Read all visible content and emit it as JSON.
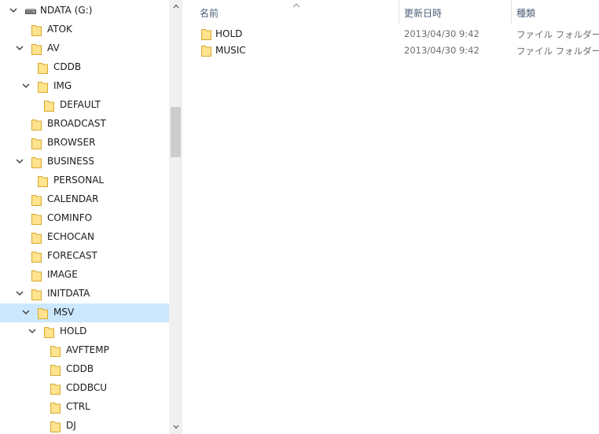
{
  "tree": {
    "drive": {
      "label": "NDATA (G:)",
      "expanded": true
    },
    "items": [
      {
        "label": "ATOK",
        "depth": 1,
        "expander": "none"
      },
      {
        "label": "AV",
        "depth": 1,
        "expander": "expanded"
      },
      {
        "label": "CDDB",
        "depth": 2,
        "expander": "none"
      },
      {
        "label": "IMG",
        "depth": 2,
        "expander": "expanded"
      },
      {
        "label": "DEFAULT",
        "depth": 3,
        "expander": "none"
      },
      {
        "label": "BROADCAST",
        "depth": 1,
        "expander": "none"
      },
      {
        "label": "BROWSER",
        "depth": 1,
        "expander": "none"
      },
      {
        "label": "BUSINESS",
        "depth": 1,
        "expander": "expanded"
      },
      {
        "label": "PERSONAL",
        "depth": 2,
        "expander": "none"
      },
      {
        "label": "CALENDAR",
        "depth": 1,
        "expander": "none"
      },
      {
        "label": "COMINFO",
        "depth": 1,
        "expander": "none"
      },
      {
        "label": "ECHOCAN",
        "depth": 1,
        "expander": "none"
      },
      {
        "label": "FORECAST",
        "depth": 1,
        "expander": "none"
      },
      {
        "label": "IMAGE",
        "depth": 1,
        "expander": "none"
      },
      {
        "label": "INITDATA",
        "depth": 1,
        "expander": "expanded"
      },
      {
        "label": "MSV",
        "depth": 2,
        "expander": "expanded",
        "selected": true
      },
      {
        "label": "HOLD",
        "depth": 3,
        "expander": "expanded"
      },
      {
        "label": "AVFTEMP",
        "depth": 4,
        "expander": "none"
      },
      {
        "label": "CDDB",
        "depth": 4,
        "expander": "none"
      },
      {
        "label": "CDDBCU",
        "depth": 4,
        "expander": "none"
      },
      {
        "label": "CTRL",
        "depth": 4,
        "expander": "none"
      },
      {
        "label": "DJ",
        "depth": 4,
        "expander": "none"
      }
    ]
  },
  "columns": {
    "name": "名前",
    "modified": "更新日時",
    "type": "種類"
  },
  "files": [
    {
      "name": "HOLD",
      "modified": "2013/04/30 9:42",
      "type": "ファイル フォルダー"
    },
    {
      "name": "MUSIC",
      "modified": "2013/04/30 9:42",
      "type": "ファイル フォルダー"
    }
  ],
  "colors": {
    "selection": "#cce8ff",
    "folder_fill": "#ffe38f",
    "folder_stroke": "#d6a92d",
    "header_text": "#4c607a"
  },
  "icons": {
    "drive": "drive-icon",
    "folder": "folder-icon",
    "expanded": "chevron-down-icon",
    "sort": "sort-up-icon"
  }
}
